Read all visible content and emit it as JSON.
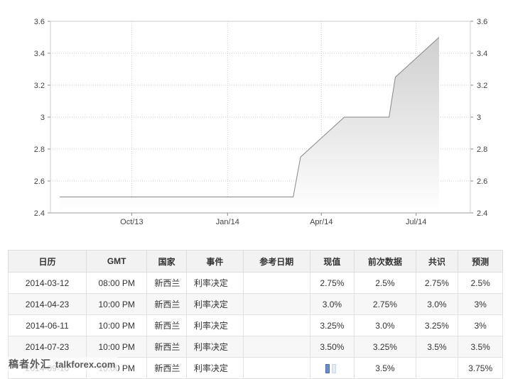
{
  "chart_data": {
    "type": "area",
    "y_ticks": [
      "2.4",
      "2.6",
      "2.8",
      "3",
      "3.2",
      "3.4",
      "3.6"
    ],
    "ylim": [
      2.4,
      3.6
    ],
    "x_tick_labels": [
      "Oct/13",
      "Jan/14",
      "Apr/14",
      "Jul/14"
    ],
    "grid": true,
    "series": [
      {
        "values": [
          {
            "x": "2013-07-24",
            "y": 2.5
          },
          {
            "x": "2014-03-05",
            "y": 2.5
          },
          {
            "x": "2014-03-12",
            "y": 2.75
          },
          {
            "x": "2014-04-23",
            "y": 3.0
          },
          {
            "x": "2014-06-05",
            "y": 3.0
          },
          {
            "x": "2014-06-11",
            "y": 3.25
          },
          {
            "x": "2014-07-23",
            "y": 3.5
          }
        ]
      }
    ],
    "colors": {
      "line": "#888888",
      "fill_top": "#cfcfcf",
      "fill_bottom": "#ffffff",
      "grid": "#cccccc"
    }
  },
  "table": {
    "headers": [
      "日历",
      "GMT",
      "国家",
      "事件",
      "参考日期",
      "现值",
      "前次数据",
      "共识",
      "预测"
    ],
    "rows": [
      [
        "2014-03-12",
        "08:00 PM",
        "新西兰",
        "利率决定",
        "",
        "2.75%",
        "2.5%",
        "2.75%",
        "2.5%"
      ],
      [
        "2014-04-23",
        "10:00 PM",
        "新西兰",
        "利率决定",
        "",
        "3.0%",
        "2.75%",
        "3.0%",
        "3%"
      ],
      [
        "2014-06-11",
        "10:00 PM",
        "新西兰",
        "利率决定",
        "",
        "3.25%",
        "3.0%",
        "3.25%",
        "3%"
      ],
      [
        "2014-07-23",
        "10:00 PM",
        "新西兰",
        "利率决定",
        "",
        "3.50%",
        "3.25%",
        "3.5%",
        "3.5%"
      ],
      [
        "2014-09-10",
        "10:00 PM",
        "新西兰",
        "利率决定",
        "",
        "",
        "3.5%",
        "",
        "3.75%"
      ]
    ]
  },
  "watermark": {
    "cn": "稿者外汇",
    "en": "talkforex.com"
  }
}
